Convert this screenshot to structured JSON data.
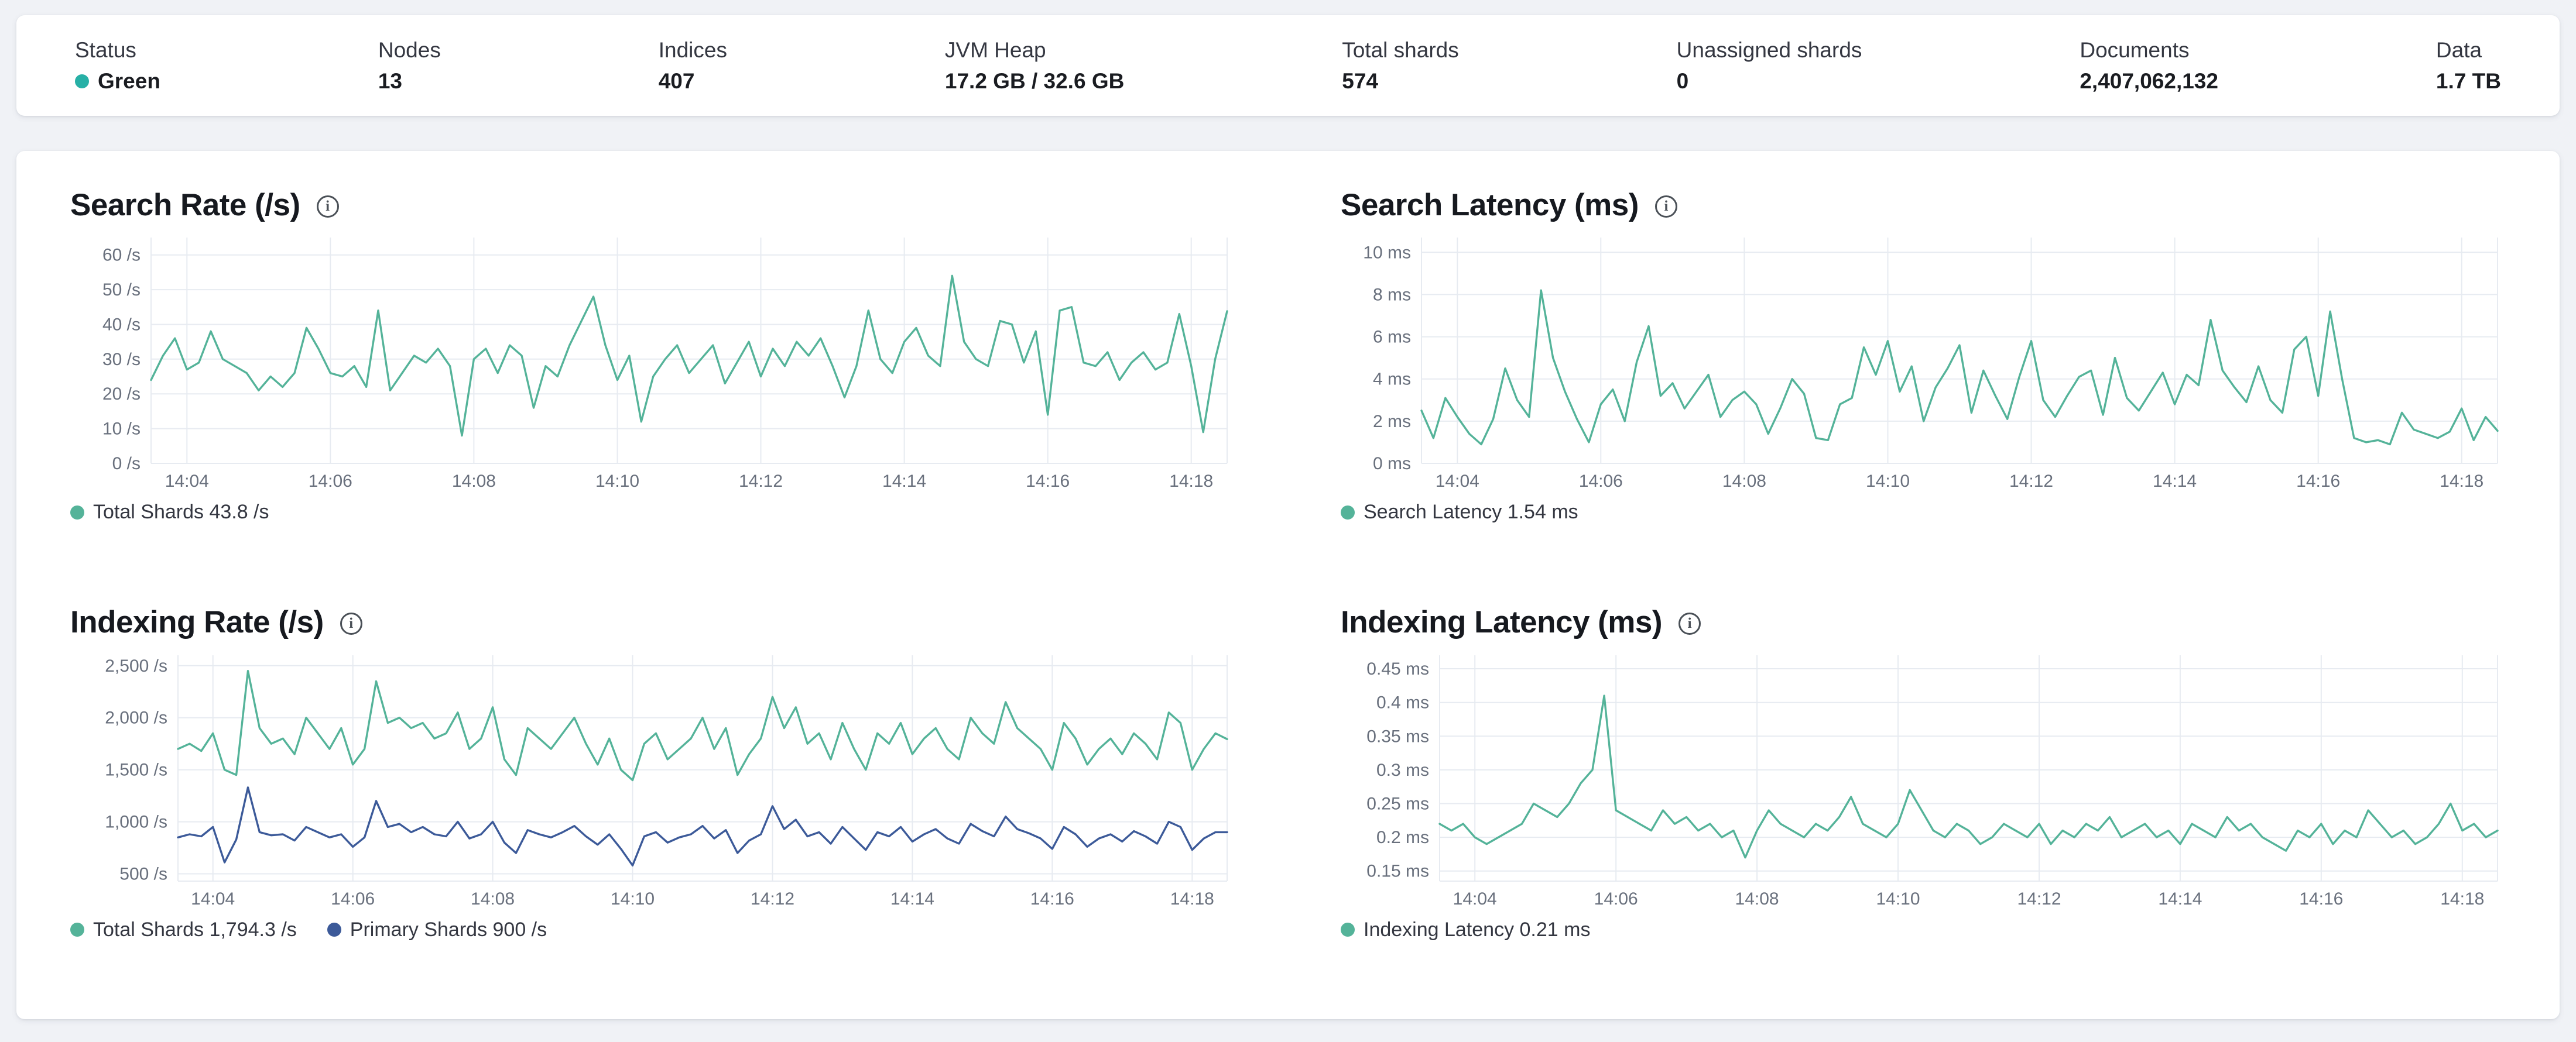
{
  "colors": {
    "teal": "#54b399",
    "blue": "#3c5a99",
    "status_green": "#27b0a6",
    "grid": "#e7ebf1",
    "axis_text": "#69707d"
  },
  "icons": {
    "info": "i"
  },
  "overview": {
    "stats": [
      {
        "label": "Status",
        "value": "Green"
      },
      {
        "label": "Nodes",
        "value": "13"
      },
      {
        "label": "Indices",
        "value": "407"
      },
      {
        "label": "JVM Heap",
        "value": "17.2 GB / 32.6 GB"
      },
      {
        "label": "Total shards",
        "value": "574"
      },
      {
        "label": "Unassigned shards",
        "value": "0"
      },
      {
        "label": "Documents",
        "value": "2,407,062,132"
      },
      {
        "label": "Data",
        "value": "1.7 TB"
      }
    ]
  },
  "chart_data": [
    {
      "type": "line",
      "title": "Search Rate (/s)",
      "x_ticks": [
        "14:04",
        "14:06",
        "14:08",
        "14:10",
        "14:12",
        "14:14",
        "14:16",
        "14:18"
      ],
      "y_tick_values": [
        0,
        10,
        20,
        30,
        40,
        50,
        60
      ],
      "y_tick_labels": [
        "0 /s",
        "10 /s",
        "20 /s",
        "30 /s",
        "40 /s",
        "50 /s",
        "60 /s"
      ],
      "ylim": [
        0,
        65
      ],
      "series": [
        {
          "name": "Total Shards",
          "color": "teal",
          "values": [
            24,
            31,
            36,
            27,
            29,
            38,
            30,
            28,
            26,
            21,
            25,
            22,
            26,
            39,
            33,
            26,
            25,
            28,
            22,
            44,
            21,
            26,
            31,
            29,
            33,
            28,
            8,
            30,
            33,
            26,
            34,
            31,
            16,
            28,
            25,
            34,
            41,
            48,
            34,
            24,
            31,
            12,
            25,
            30,
            34,
            26,
            30,
            34,
            23,
            29,
            35,
            25,
            33,
            28,
            35,
            31,
            36,
            28,
            19,
            28,
            44,
            30,
            26,
            35,
            39,
            31,
            28,
            54,
            35,
            30,
            28,
            41,
            40,
            29,
            38,
            14,
            44,
            45,
            29,
            28,
            32,
            24,
            29,
            32,
            27,
            29,
            43,
            28,
            9,
            30,
            43.8
          ]
        }
      ],
      "legend": [
        {
          "label": "Total Shards 43.8 /s",
          "color": "teal"
        }
      ]
    },
    {
      "type": "line",
      "title": "Search Latency (ms)",
      "x_ticks": [
        "14:04",
        "14:06",
        "14:08",
        "14:10",
        "14:12",
        "14:14",
        "14:16",
        "14:18"
      ],
      "y_tick_values": [
        0,
        2,
        4,
        6,
        8,
        10
      ],
      "y_tick_labels": [
        "0 ms",
        "2 ms",
        "4 ms",
        "6 ms",
        "8 ms",
        "10 ms"
      ],
      "ylim": [
        0,
        10.7
      ],
      "series": [
        {
          "name": "Search Latency",
          "color": "teal",
          "values": [
            2.5,
            1.2,
            3.1,
            2.2,
            1.4,
            0.9,
            2.1,
            4.5,
            3.0,
            2.2,
            8.2,
            5.0,
            3.4,
            2.1,
            1.0,
            2.8,
            3.5,
            2.0,
            4.8,
            6.5,
            3.2,
            3.8,
            2.6,
            3.4,
            4.2,
            2.2,
            3.0,
            3.4,
            2.8,
            1.4,
            2.6,
            4.0,
            3.3,
            1.2,
            1.1,
            2.8,
            3.1,
            5.5,
            4.2,
            5.8,
            3.4,
            4.6,
            2.0,
            3.6,
            4.5,
            5.6,
            2.4,
            4.4,
            3.2,
            2.1,
            4.1,
            5.8,
            3.0,
            2.2,
            3.2,
            4.1,
            4.4,
            2.3,
            5.0,
            3.1,
            2.5,
            3.4,
            4.3,
            2.8,
            4.2,
            3.7,
            6.8,
            4.4,
            3.6,
            2.9,
            4.6,
            3.0,
            2.4,
            5.4,
            6.0,
            3.2,
            7.2,
            4.0,
            1.2,
            1.0,
            1.1,
            0.9,
            2.4,
            1.6,
            1.4,
            1.2,
            1.5,
            2.6,
            1.1,
            2.2,
            1.54
          ]
        }
      ],
      "legend": [
        {
          "label": "Search Latency 1.54 ms",
          "color": "teal"
        }
      ]
    },
    {
      "type": "line",
      "title": "Indexing Rate (/s)",
      "x_ticks": [
        "14:04",
        "14:06",
        "14:08",
        "14:10",
        "14:12",
        "14:14",
        "14:16",
        "14:18"
      ],
      "y_tick_values": [
        500,
        1000,
        1500,
        2000,
        2500
      ],
      "y_tick_labels": [
        "500 /s",
        "1,000 /s",
        "1,500 /s",
        "2,000 /s",
        "2,500 /s"
      ],
      "ylim": [
        430,
        2600
      ],
      "series": [
        {
          "name": "Total Shards",
          "color": "teal",
          "values": [
            1700,
            1750,
            1680,
            1850,
            1500,
            1450,
            2450,
            1900,
            1750,
            1800,
            1650,
            2000,
            1850,
            1700,
            1900,
            1550,
            1700,
            2350,
            1950,
            2000,
            1900,
            1950,
            1800,
            1850,
            2050,
            1700,
            1800,
            2100,
            1600,
            1450,
            1900,
            1800,
            1700,
            1850,
            2000,
            1750,
            1550,
            1800,
            1500,
            1400,
            1750,
            1850,
            1600,
            1700,
            1800,
            2000,
            1700,
            1900,
            1450,
            1650,
            1800,
            2200,
            1900,
            2100,
            1750,
            1850,
            1600,
            1950,
            1700,
            1500,
            1850,
            1750,
            1950,
            1650,
            1800,
            1900,
            1700,
            1600,
            2000,
            1850,
            1750,
            2150,
            1900,
            1800,
            1700,
            1500,
            1950,
            1800,
            1550,
            1700,
            1800,
            1650,
            1850,
            1750,
            1600,
            2050,
            1950,
            1500,
            1700,
            1850,
            1794.3
          ]
        },
        {
          "name": "Primary Shards",
          "color": "blue",
          "values": [
            850,
            880,
            860,
            950,
            610,
            830,
            1330,
            900,
            870,
            880,
            820,
            950,
            900,
            850,
            880,
            760,
            850,
            1200,
            950,
            980,
            900,
            950,
            880,
            860,
            1000,
            840,
            880,
            1000,
            800,
            700,
            920,
            880,
            850,
            900,
            960,
            860,
            780,
            880,
            740,
            580,
            860,
            900,
            800,
            850,
            880,
            960,
            840,
            920,
            700,
            820,
            880,
            1150,
            930,
            1020,
            860,
            900,
            790,
            950,
            840,
            730,
            900,
            860,
            950,
            810,
            880,
            930,
            840,
            790,
            980,
            910,
            860,
            1050,
            930,
            890,
            840,
            740,
            950,
            880,
            760,
            840,
            880,
            810,
            910,
            860,
            790,
            1000,
            950,
            730,
            840,
            900,
            900
          ]
        }
      ],
      "legend": [
        {
          "label": "Total Shards 1,794.3 /s",
          "color": "teal"
        },
        {
          "label": "Primary Shards 900 /s",
          "color": "blue"
        }
      ]
    },
    {
      "type": "line",
      "title": "Indexing Latency (ms)",
      "x_ticks": [
        "14:04",
        "14:06",
        "14:08",
        "14:10",
        "14:12",
        "14:14",
        "14:16",
        "14:18"
      ],
      "y_tick_values": [
        0.15,
        0.2,
        0.25,
        0.3,
        0.35,
        0.4,
        0.45
      ],
      "y_tick_labels": [
        "0.15 ms",
        "0.2 ms",
        "0.25 ms",
        "0.3 ms",
        "0.35 ms",
        "0.4 ms",
        "0.45 ms"
      ],
      "ylim": [
        0.135,
        0.47
      ],
      "series": [
        {
          "name": "Indexing Latency",
          "color": "teal",
          "values": [
            0.22,
            0.21,
            0.22,
            0.2,
            0.19,
            0.2,
            0.21,
            0.22,
            0.25,
            0.24,
            0.23,
            0.25,
            0.28,
            0.3,
            0.41,
            0.24,
            0.23,
            0.22,
            0.21,
            0.24,
            0.22,
            0.23,
            0.21,
            0.22,
            0.2,
            0.21,
            0.17,
            0.21,
            0.24,
            0.22,
            0.21,
            0.2,
            0.22,
            0.21,
            0.23,
            0.26,
            0.22,
            0.21,
            0.2,
            0.22,
            0.27,
            0.24,
            0.21,
            0.2,
            0.22,
            0.21,
            0.19,
            0.2,
            0.22,
            0.21,
            0.2,
            0.22,
            0.19,
            0.21,
            0.2,
            0.22,
            0.21,
            0.23,
            0.2,
            0.21,
            0.22,
            0.2,
            0.21,
            0.19,
            0.22,
            0.21,
            0.2,
            0.23,
            0.21,
            0.22,
            0.2,
            0.19,
            0.18,
            0.21,
            0.2,
            0.22,
            0.19,
            0.21,
            0.2,
            0.24,
            0.22,
            0.2,
            0.21,
            0.19,
            0.2,
            0.22,
            0.25,
            0.21,
            0.22,
            0.2,
            0.21
          ]
        }
      ],
      "legend": [
        {
          "label": "Indexing Latency 0.21 ms",
          "color": "teal"
        }
      ]
    }
  ]
}
